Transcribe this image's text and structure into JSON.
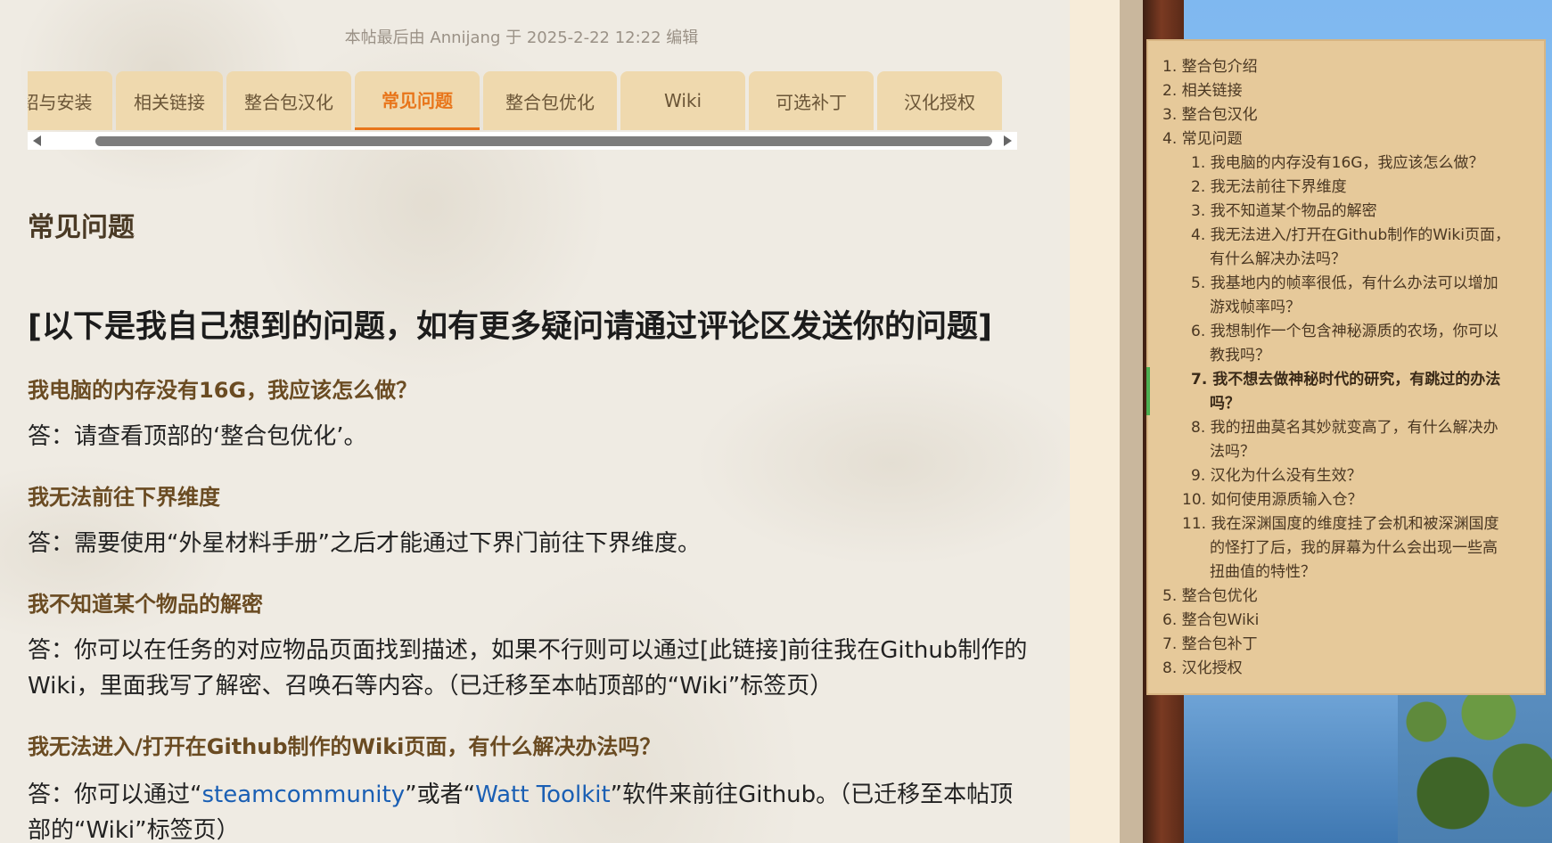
{
  "edit_note": "本帖最后由 Annijang 于 2025-2-22 12:22 编辑",
  "tabs": [
    {
      "label": "绍与安装"
    },
    {
      "label": "相关链接"
    },
    {
      "label": "整合包汉化"
    },
    {
      "label": "常见问题",
      "active": true
    },
    {
      "label": "整合包优化"
    },
    {
      "label": "Wiki"
    },
    {
      "label": "可选补丁"
    },
    {
      "label": "汉化授权"
    }
  ],
  "section_title": "常见问题",
  "intro_heading": "[以下是我自己想到的问题，如有更多疑问请通过评论区发送你的问题]",
  "faq": [
    {
      "q": "我电脑的内存没有16G，我应该怎么做？",
      "a": "答：请查看顶部的‘整合包优化’。"
    },
    {
      "q": "我无法前往下界维度",
      "a": "答：需要使用“外星材料手册”之后才能通过下界门前往下界维度。"
    },
    {
      "q": "我不知道某个物品的解密",
      "a": "答：你可以在任务的对应物品页面找到描述，如果不行则可以通过[此链接]前往我在Github制作的Wiki，里面我写了解密、召唤石等内容。（已迁移至本帖顶部的“Wiki”标签页）"
    },
    {
      "q": "我无法进入/打开在Github制作的Wiki页面，有什么解决办法吗？",
      "a_parts": {
        "pre": "答：你可以通过“",
        "link1": "steamcommunity",
        "mid": "”或者“",
        "link2": "Watt Toolkit",
        "post": "”软件来前往Github。（已迁移至本帖顶部的“Wiki”标签页）"
      }
    }
  ],
  "toc": [
    {
      "num": "1.",
      "label": "整合包介绍"
    },
    {
      "num": "2.",
      "label": "相关链接"
    },
    {
      "num": "3.",
      "label": "整合包汉化"
    },
    {
      "num": "4.",
      "label": "常见问题"
    },
    {
      "num": "1.",
      "label": "我电脑的内存没有16G，我应该怎么做？"
    },
    {
      "num": "2.",
      "label": "我无法前往下界维度"
    },
    {
      "num": "3.",
      "label": "我不知道某个物品的解密"
    },
    {
      "num": "4.",
      "label": "我无法进入/打开在Github制作的Wiki页面，",
      "label2": "有什么解决办法吗？"
    },
    {
      "num": "5.",
      "label": "我基地内的帧率很低，有什么办法可以增加",
      "label2": "游戏帧率吗？"
    },
    {
      "num": "6.",
      "label": "我想制作一个包含神秘源质的农场，你可以",
      "label2": "教我吗？"
    },
    {
      "num": "7.",
      "label": "我不想去做神秘时代的研究，有跳过的办法",
      "label2": "吗？",
      "current": true
    },
    {
      "num": "8.",
      "label": "我的扭曲莫名其妙就变高了，有什么解决办",
      "label2": "法吗？"
    },
    {
      "num": "9.",
      "label": "汉化为什么没有生效？"
    },
    {
      "num": "10.",
      "label": "如何使用源质输入仓？"
    },
    {
      "num": "11.",
      "label": "我在深渊国度的维度挂了会机和被深渊国度",
      "label2": "的怪打了后，我的屏幕为什么会出现一些高",
      "label3": "扭曲值的特性？"
    },
    {
      "num": "5.",
      "label": "整合包优化"
    },
    {
      "num": "6.",
      "label": "整合包Wiki"
    },
    {
      "num": "7.",
      "label": "整合包补丁"
    },
    {
      "num": "8.",
      "label": "汉化授权"
    }
  ],
  "colors": {
    "active_tab": "#e8751a",
    "toc_marker": "#4caf50",
    "link": "#1a5fb4"
  }
}
